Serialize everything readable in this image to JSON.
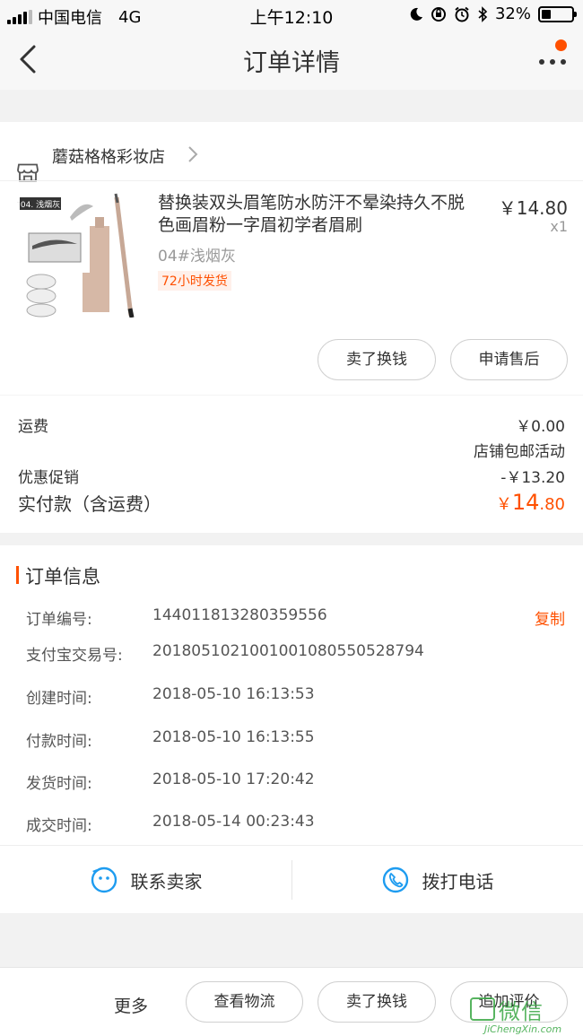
{
  "status_bar": {
    "carrier": "中国电信",
    "network": "4G",
    "time": "上午12:10",
    "battery": "32%",
    "battery_level": 0.32
  },
  "nav": {
    "title": "订单详情"
  },
  "shop": {
    "name": "蘑菇格格彩妆店"
  },
  "product": {
    "title": "替换装双头眉笔防水防汗不晕染持久不脱色画眉粉一字眉初学者眉刷",
    "spec": "04#浅烟灰",
    "tag": "72小时发货",
    "price": "￥14.80",
    "qty": "x1",
    "image_label": "04. 浅烟灰",
    "actions": [
      "卖了换钱",
      "申请售后"
    ]
  },
  "summary": {
    "shipping_label": "运费",
    "shipping_value": "￥0.00",
    "shipping_note": "店铺包邮活动",
    "promo_label": "优惠促销",
    "promo_value": "-￥13.20",
    "total_label": "实付款（含运费）",
    "total_currency": "￥",
    "total_int": "14",
    "total_dec": ".80"
  },
  "order_info": {
    "title": "订单信息",
    "copy": "复制",
    "rows": [
      {
        "label": "订单编号:",
        "value": "144011813280359556"
      },
      {
        "label": "支付宝交易号:",
        "value": "2018051021001001080550528794"
      },
      {
        "label": "创建时间:",
        "value": "2018-05-10 16:13:53"
      },
      {
        "label": "付款时间:",
        "value": "2018-05-10 16:13:55"
      },
      {
        "label": "发货时间:",
        "value": "2018-05-10 17:20:42"
      },
      {
        "label": "成交时间:",
        "value": "2018-05-14 00:23:43"
      }
    ]
  },
  "contact": {
    "seller": "联系卖家",
    "call": "拨打电话"
  },
  "bottom": {
    "more": "更多",
    "buttons": [
      "查看物流",
      "卖了换钱",
      "追加评价"
    ]
  },
  "watermark": {
    "cn": "微信",
    "domain": "JiChengXin.com"
  }
}
